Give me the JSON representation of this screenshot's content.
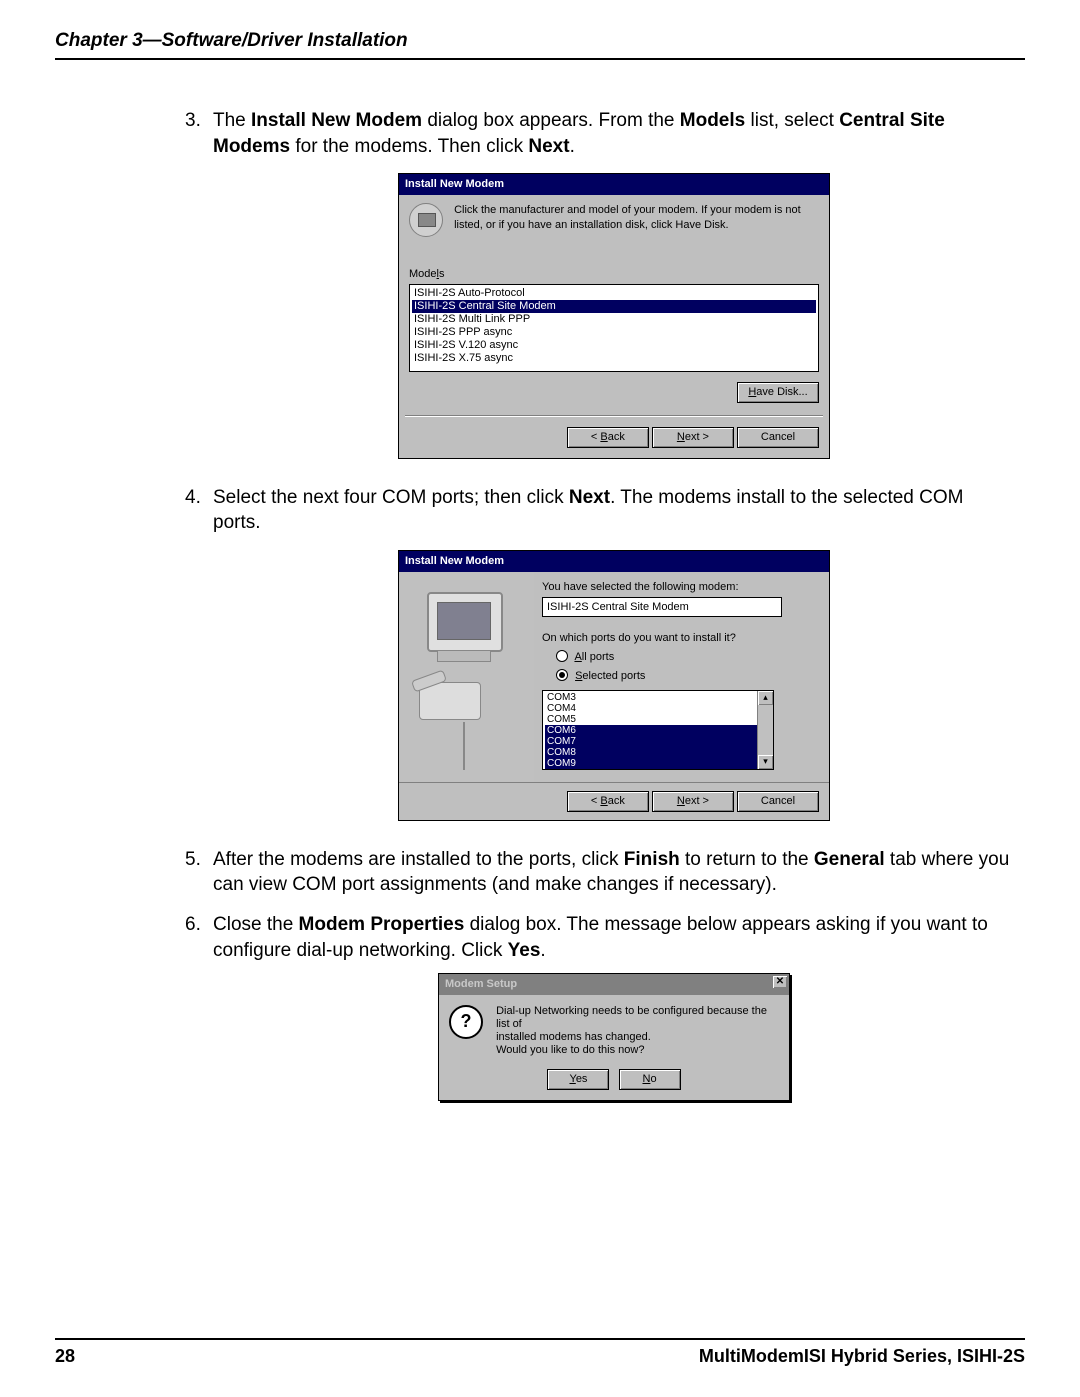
{
  "header": {
    "chapter_title": "Chapter 3—Software/Driver Installation"
  },
  "steps": {
    "s3": {
      "num": "3.",
      "p1": "The ",
      "b1": "Install New Modem",
      "p2": " dialog box appears. From the ",
      "b2": "Models",
      "p3": " list, select ",
      "b3": "Central Site Modems",
      "p4": " for the modems. Then click ",
      "b4": "Next",
      "p5": "."
    },
    "s4": {
      "num": "4.",
      "p1": "Select the next four COM ports; then click ",
      "b1": "Next",
      "p2": ". The modems install to the selected COM ports."
    },
    "s5": {
      "num": "5.",
      "p1": "After the modems are installed to the ports, click ",
      "b1": "Finish",
      "p2": " to return to the ",
      "b2": "General",
      "p3": " tab where you can view COM port assignments (and make changes if necessary)."
    },
    "s6": {
      "num": "6.",
      "p1": "Close the ",
      "b1": "Modem Properties",
      "p2": " dialog box. The message below appears asking if you want to configure dial-up networking. Click ",
      "b2": "Yes",
      "p3": "."
    }
  },
  "dlg1": {
    "title": "Install New Modem",
    "intro": "Click the manufacturer and model of your modem. If your modem is not listed, or if you have an installation disk, click Have Disk.",
    "models_label_pre": "Mode",
    "models_label_u": "l",
    "models_label_post": "s",
    "items": {
      "i0": "ISIHI-2S Auto-Protocol",
      "i1": "ISIHI-2S Central Site Modem",
      "i2": "ISIHI-2S Multi Link PPP",
      "i3": "ISIHI-2S PPP async",
      "i4": "ISIHI-2S V.120 async",
      "i5": "ISIHI-2S X.75 async"
    },
    "have_disk_u": "H",
    "have_disk_post": "ave Disk...",
    "back_pre": "< ",
    "back_u": "B",
    "back_post": "ack",
    "next_u": "N",
    "next_post": "ext >",
    "cancel": "Cancel"
  },
  "dlg2": {
    "title": "Install New Modem",
    "selected_label": "You have selected the following modem:",
    "selected_value": "ISIHI-2S Central Site Modem",
    "ports_question": "On which ports do you want to install it?",
    "all_u": "A",
    "all_post": "ll ports",
    "sel_u": "S",
    "sel_post": "elected ports",
    "ports": {
      "p0": "COM3",
      "p1": "COM4",
      "p2": "COM5",
      "p3": "COM6",
      "p4": "COM7",
      "p5": "COM8",
      "p6": "COM9"
    },
    "back_pre": "< ",
    "back_u": "B",
    "back_post": "ack",
    "next_u": "N",
    "next_post": "ext >",
    "cancel": "Cancel",
    "scroll_up": "▴",
    "scroll_down": "▾"
  },
  "dlg3": {
    "title": "Modem Setup",
    "msg_l1": "Dial-up Networking needs to be configured because the list of",
    "msg_l2": "installed modems has changed.",
    "msg_l3": "Would you like to do this now?",
    "q": "?",
    "close": "✕",
    "yes_u": "Y",
    "yes_post": "es",
    "no_u": "N",
    "no_post": "o"
  },
  "footer": {
    "page": "28",
    "doc": "MultiModemISI Hybrid Series, ISIHI-2S"
  }
}
